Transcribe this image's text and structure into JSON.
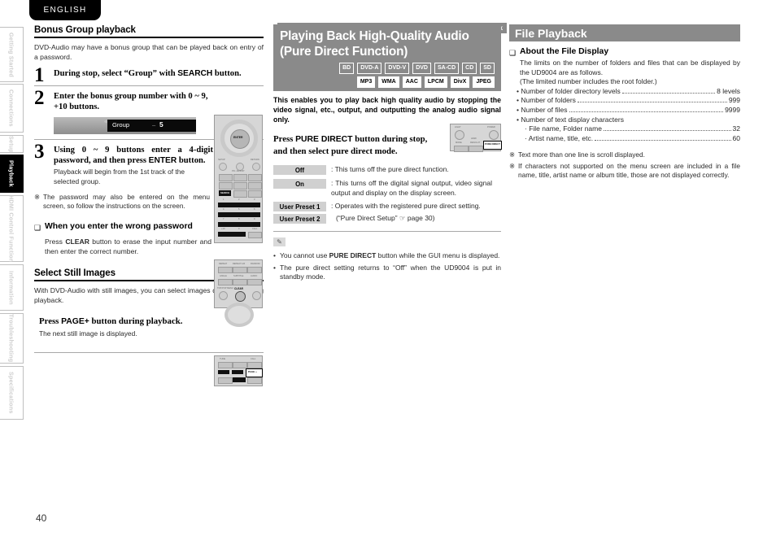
{
  "page": {
    "number": "40",
    "language_tab": "ENGLISH",
    "running_head": "DVD-Audio Playback"
  },
  "sidebar": {
    "items": [
      {
        "label": "Getting Started",
        "active": false
      },
      {
        "label": "Connections",
        "active": false
      },
      {
        "label": "Setup",
        "active": false
      },
      {
        "label": "Playback",
        "active": true
      },
      {
        "label": "HDMI Control Function",
        "active": false
      },
      {
        "label": "Information",
        "active": false
      },
      {
        "label": "Troubleshooting",
        "active": false
      },
      {
        "label": "Specifications",
        "active": false
      }
    ]
  },
  "left_column": {
    "section1": {
      "heading": "Bonus Group playback",
      "intro": "DVD-Audio may have a bonus group that can be played back on entry of a password.",
      "steps": [
        {
          "number": "1",
          "title_pre": "During stop, select “Group” with ",
          "title_strong": "SEARCH",
          "title_post": " button."
        },
        {
          "number": "2",
          "title_pre": "Enter the bonus group number with 0 ~ 9, +10 buttons.",
          "title_strong": "",
          "title_post": ""
        },
        {
          "number": "3",
          "title_pre": "Using 0 ~ 9 buttons enter a 4-digit password, and then press ",
          "title_strong": "ENTER",
          "title_post": " button.",
          "sub": "Playback will begin from the 1st track of the selected group."
        }
      ],
      "osd": {
        "label": "Group",
        "dash": "–",
        "value": "5"
      },
      "note": {
        "mark": "※",
        "text": "The password may also be entered on the menu screen, so follow the instructions on the screen."
      }
    },
    "section2": {
      "square": "❑",
      "heading": "When you enter the wrong password",
      "body_pre": "Press ",
      "body_strong": "CLEAR",
      "body_post": " button to erase the input number and then enter the correct number."
    },
    "section3": {
      "heading": "Select Still Images",
      "intro": "With DVD-Audio with still images, you can select images displayed during playback.",
      "press_pre": "Press ",
      "press_strong": "PAGE+",
      "press_post": " button during playback.",
      "sub": "The next still image is displayed."
    }
  },
  "mid_column": {
    "title_line1": "Playing Back High-Quality Audio",
    "title_line2": "(Pure Direct Function)",
    "badges_row1": [
      "BD",
      "DVD-A",
      "DVD-V",
      "DVD",
      "SA-CD",
      "CD",
      "SD"
    ],
    "badges_row2": [
      "MP3",
      "WMA",
      "AAC",
      "LPCM",
      "DivX",
      "JPEG"
    ],
    "intro": "This enables you to play back high quality audio by stopping the video signal, etc., output, and outputting the analog audio signal only.",
    "press_pre": "Press ",
    "press_strong": "PURE DIRECT",
    "press_post": " button during stop, and then select pure direct mode.",
    "options": [
      {
        "key": "Off",
        "value": "This turns off the pure direct function."
      },
      {
        "key": "On",
        "value": "This turns off the digital signal output, video signal output and display on the display screen."
      },
      {
        "key": "User Preset 1",
        "value": "Operates with the registered pure direct setting."
      },
      {
        "key": "User Preset 2",
        "value": "(“Pure Direct Setup” ☞ page 30)"
      }
    ],
    "pencil_icon": "✎",
    "notes": [
      {
        "pre": "You cannot use ",
        "strong": "PURE DIRECT",
        "post": " button while the GUI menu is displayed."
      },
      {
        "pre": "The pure direct setting returns to “Off” when the UD9004 is put in standby mode.",
        "strong": "",
        "post": ""
      }
    ]
  },
  "right_column": {
    "heading": "File Playback",
    "square": "❑",
    "subheading": "About the File Display",
    "intro1": "The limits on the number of folders and files that can be displayed by the UD9004 are as follows.",
    "intro2": "(The limited number includes the root folder.)",
    "specs": [
      {
        "label": "• Number of folder directory levels",
        "value": "8 levels"
      },
      {
        "label": "• Number of folders",
        "value": "999"
      },
      {
        "label": "• Number of files",
        "value": "9999"
      }
    ],
    "text_chars_label": "• Number of text display characters",
    "text_chars": [
      {
        "label": "· File name, Folder name",
        "value": "32"
      },
      {
        "label": "· Artist name, title, etc.",
        "value": "60"
      }
    ],
    "notes": [
      {
        "mark": "※",
        "text": "Text more than one line is scroll displayed."
      },
      {
        "mark": "※",
        "text": "If characters not supported on the menu screen are included in a file name, title, artist name or album title, those are not displayed correctly."
      }
    ]
  },
  "remotes": {
    "remote_enter": {
      "center_label": "ENTER",
      "keys": [
        "SETUP",
        "PIC. ADJUST",
        "RETURN",
        "CLEAR",
        "TOP/POP MENU"
      ],
      "numbers": [
        "1",
        "2",
        "3",
        "4",
        "5",
        "6",
        "7",
        "8",
        "9",
        "+10",
        "0",
        "CALL"
      ]
    },
    "remote_clear": {
      "highlight": "CLEAR",
      "row1": [
        "REPEAT",
        "REPEAT A-B",
        "RANDOM"
      ],
      "row2": [
        "ANGLE",
        "SUBTITLE",
        "AUDIO"
      ]
    },
    "remote_page": {
      "highlight": "PAGE +"
    },
    "remote_pure_direct": {
      "highlight": "PURE DIRECT"
    }
  },
  "colors": {
    "header_gray": "#8a8a8a",
    "active_tab": "#000000",
    "body_text": "#2a2a2a"
  }
}
